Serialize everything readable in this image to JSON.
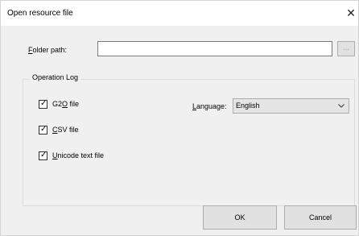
{
  "window": {
    "title": "Open resource file",
    "close_glyph": "✕"
  },
  "folder": {
    "label_key": "F",
    "label_rest": "older path:",
    "value": "",
    "browse_label": "..."
  },
  "operation_log": {
    "title": "Operation Log",
    "items": [
      {
        "pre": "G2",
        "key": "O",
        "post": " file",
        "checked": true
      },
      {
        "pre": "",
        "key": "C",
        "post": "SV file",
        "checked": true
      },
      {
        "pre": "",
        "key": "U",
        "post": "nicode text file",
        "checked": true
      }
    ],
    "language_label_key": "L",
    "language_label_rest": "anguage:",
    "language_value": "English"
  },
  "buttons": {
    "ok": "OK",
    "cancel": "Cancel"
  },
  "icons": {
    "close": "close-icon",
    "check": "check-icon",
    "chevron": "chevron-down-icon"
  }
}
